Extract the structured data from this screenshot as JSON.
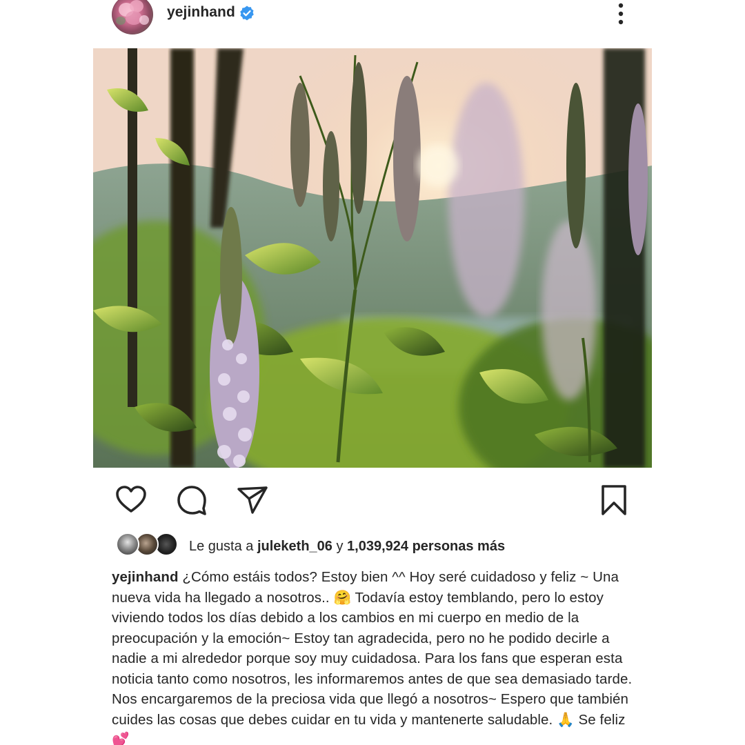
{
  "post": {
    "username": "yejinhand",
    "verified": true,
    "avatar_icon": "profile-photo-pink-flowers",
    "more_icon": "vertical-ellipsis-icon"
  },
  "actions": {
    "like_icon": "heart-outline-icon",
    "comment_icon": "speech-bubble-icon",
    "share_icon": "paper-plane-icon",
    "save_icon": "bookmark-outline-icon"
  },
  "likes": {
    "prefix": "Le gusta a ",
    "first_user": "juleketh_06",
    "connector": " y ",
    "count": "1,039,924 personas más"
  },
  "caption": {
    "username": "yejinhand",
    "text": " ¿Cómo estáis todos? Estoy bien ^^ Hoy seré cuidadoso y feliz ~ Una nueva vida ha llegado a nosotros.. 🤗 Todavía estoy temblando, pero lo estoy viviendo todos los días debido a los cambios en mi cuerpo en medio de la preocupación y la emoción~ Estoy tan agradecida, pero no he podido decirle a nadie a mi alrededor porque soy muy cuidadosa. Para los fans que esperan esta noticia tanto como nosotros, les informaremos antes de que sea demasiado tarde. Nos encargaremos de la preciosa vida que llegó a nosotros~ Espero que también cuides las cosas que debes cuidar en tu vida y mantenerte saludable. 🙏 Se feliz💕"
  },
  "colors": {
    "text": "#262626",
    "verified_blue": "#3897f0",
    "background": "#ffffff"
  }
}
